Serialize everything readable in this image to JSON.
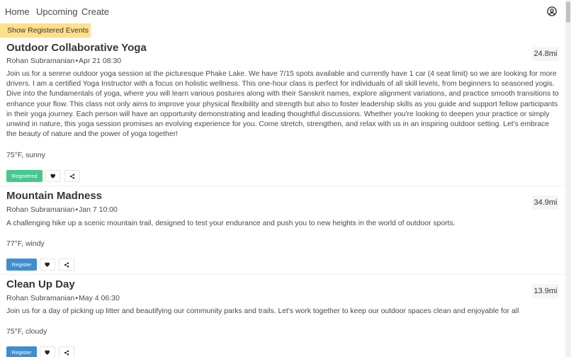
{
  "nav": {
    "home_label": "Home",
    "upcoming_label": "Upcoming",
    "create_label": "Create",
    "account_icon": "account-circle-icon"
  },
  "filter": {
    "label": "Show Registered Events"
  },
  "colors": {
    "filter_bg": "#ffe08a",
    "registered_bg": "#48c78e",
    "register_bg": "#3e8ed0"
  },
  "events": [
    {
      "title": "Outdoor Collaborative Yoga",
      "organizer": "Rohan Subramanian",
      "separator": "•",
      "datetime": "Apr 21 08:30",
      "distance": "24.8mi",
      "description": "Join us for a serene outdoor yoga session at the picturesque Phake Lake. We have 7/15 spots available and currently have 1 car (4 seat limit) so we are looking for more drivers. I am a certified Yoga Instructor with a focus on holistic wellness. This one-hour class is perfect for individuals of all skill levels, from beginners to seasoned yogis. Dive into the fundamentals of yoga, where you will learn various postures along with their Sanskrit names, explore alignment variations, and practice smooth transitions to enhance your flow. This class not only aims to improve your physical flexibility and strength but also to foster leadership skills as you guide and support fellow participants in their yoga journey. Each person will have an opportunity demonstrating and leading thoughtful discussions. Whether you're looking to deepen your practice or simply unwind in nature, this yoga session promises an evolving experience for you. Come stretch, strengthen, and relax with us in an inspiring outdoor setting. Let's embrace the beauty of nature and the power of yoga together!",
      "weather": "75°F, sunny",
      "status_label": "Registered",
      "favorite_icon": "heart-icon",
      "share_icon": "share-icon"
    },
    {
      "title": "Mountain Madness",
      "organizer": "Rohan Subramanian",
      "separator": "•",
      "datetime": "Jan 7 10:00",
      "distance": "34.9mi",
      "description": "A challenging hike up a scenic mountain trail, designed to test your endurance and push you to new heights in the world of outdoor sports.",
      "weather": "77°F, windy",
      "status_label": "Register",
      "favorite_icon": "heart-icon",
      "share_icon": "share-icon"
    },
    {
      "title": "Clean Up Day",
      "organizer": "Rohan Subramanian",
      "separator": "•",
      "datetime": "May 4 06:30",
      "distance": "13.9mi",
      "description": "Join us for a day of picking up litter and beautifying our community parks and trails. Let's work together to keep our outdoor spaces clean and enjoyable for all",
      "weather": "75°F, cloudy",
      "status_label": "Register",
      "favorite_icon": "heart-icon",
      "share_icon": "share-icon"
    }
  ]
}
